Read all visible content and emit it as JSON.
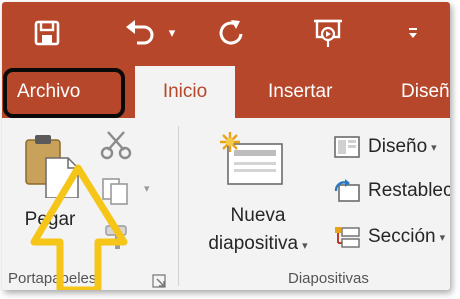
{
  "colors": {
    "accent": "#b7472a",
    "ribbon_bg": "#f3f3f3",
    "arrow": "#f5c518",
    "tab_text": "#ffffff"
  },
  "quick_access": {
    "save_icon": "save-icon",
    "undo_icon": "undo-icon",
    "undo_dropdown": "▾",
    "redo_icon": "repeat-icon",
    "present_icon": "start-from-beginning-icon",
    "customize_icon": "customize-quick-access-icon"
  },
  "tabs": [
    {
      "label": "Archivo",
      "active": false,
      "highlighted": true
    },
    {
      "label": "Inicio",
      "active": true
    },
    {
      "label": "Insertar",
      "active": false
    },
    {
      "label": "Diseño",
      "active": false
    }
  ],
  "clipboard_group": {
    "paste_label": "Pegar",
    "label": "Portapapeles",
    "launcher_icon": "dialog-launcher-icon"
  },
  "slides_group": {
    "new_slide_line1": "Nueva",
    "new_slide_line2": "diapositiva",
    "layout_label": "Diseño",
    "reset_label": "Restablecer",
    "section_label": "Sección",
    "label": "Diapositivas"
  },
  "annotation": {
    "type": "up-arrow",
    "points_to": "paste-button"
  }
}
